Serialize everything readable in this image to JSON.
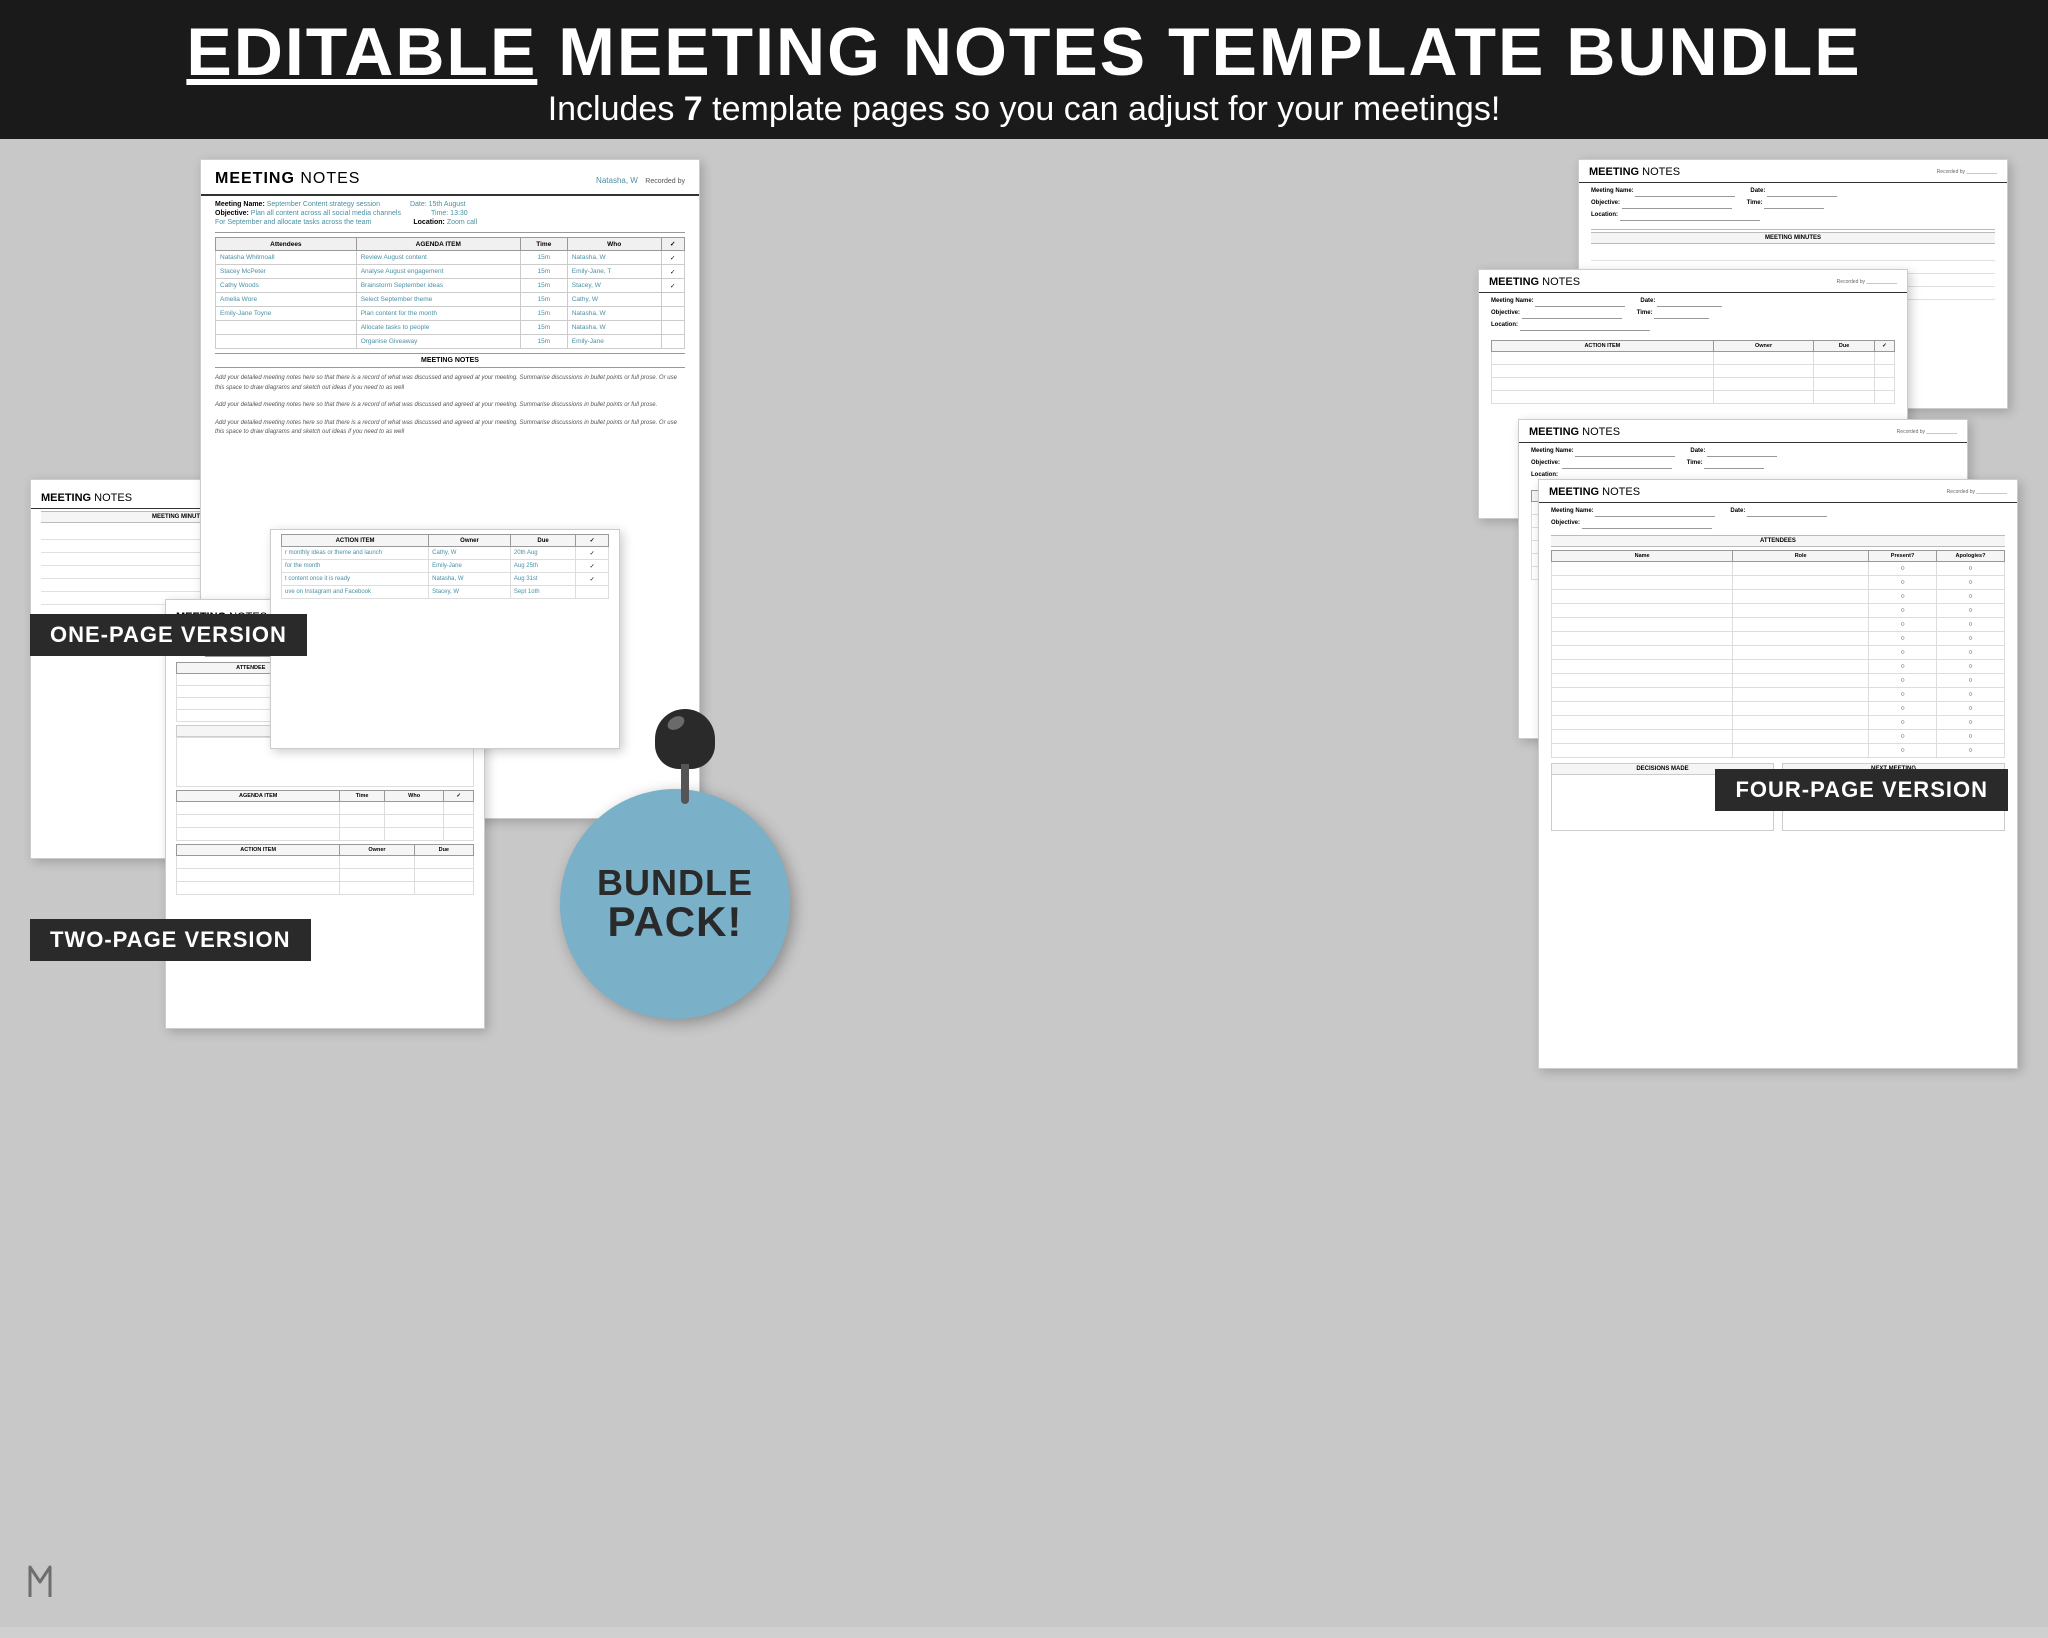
{
  "header": {
    "title_part1": "EDITABLE",
    "title_part2": " MEETING NOTES TEMPLATE BUNDLE",
    "subtitle_part1": "Includes ",
    "subtitle_bold": "7",
    "subtitle_part2": " template pages so you can adjust for your meetings!"
  },
  "versions": {
    "one_page": "ONE-PAGE VERSION",
    "two_page": "TWO-PAGE VERSION",
    "four_page": "FOUR-PAGE VERSION"
  },
  "bundle": {
    "line1": "BUNDLE",
    "line2": "PACK!"
  },
  "template_label": "MEETING",
  "notes_label": "NOTES",
  "recorded_by": "Recorded by",
  "meeting_minutes": "MEETING MINUTES",
  "agenda_item": "AGENDA ITEM",
  "action_item": "ACTION ITEM",
  "attendees": "Attendees",
  "attendees_header": "ATTENDEES",
  "time_col": "Time",
  "who_col": "Who",
  "check_col": "✓",
  "owner_col": "Owner",
  "due_col": "Due",
  "name_col": "Name",
  "role_col": "Role",
  "present_col": "Present?",
  "apologies_col": "Apologies?",
  "decisions_made": "DECISIONS MADE",
  "next_meeting": "NEXT MEETING",
  "meeting_name_label": "Meeting Name:",
  "objective_label": "Objective:",
  "date_label": "Date:",
  "time_label": "Time:",
  "location_label": "Location:",
  "sample_meeting_name": "September Content strategy session",
  "sample_date": "Date: 15th August",
  "sample_time": "Time: 13:30",
  "sample_location": "Location: Zoom call",
  "sample_objective": "Plan all content across all social media channels",
  "sample_objective2": "For September and allocate tasks across the team",
  "recorded_name": "Natasha, W",
  "attendee_rows": [
    "Natasha Whitmoall",
    "Stacey McPeter",
    "Cathy Woods",
    "Amelia Wore",
    "Emily-Jane Toyne"
  ],
  "agenda_rows": [
    {
      "item": "Review August content",
      "time": "15m",
      "who": "Natasha, W",
      "check": "✓"
    },
    {
      "item": "Analyse August engagement",
      "time": "15m",
      "who": "Emily-Jane, T",
      "check": "✓"
    },
    {
      "item": "Brainstorm September ideas",
      "time": "15m",
      "who": "Stacey, W",
      "check": "✓"
    },
    {
      "item": "Select September theme",
      "time": "15m",
      "who": "Cathy, W",
      "check": ""
    },
    {
      "item": "Plan content for the month",
      "time": "15m",
      "who": "Natasha, W",
      "check": ""
    },
    {
      "item": "Allocate tasks to people",
      "time": "15m",
      "who": "Natasha, W",
      "check": ""
    },
    {
      "item": "Organise Giveaway",
      "time": "15m",
      "who": "Emily-Jane",
      "check": ""
    }
  ],
  "action_rows": [
    {
      "item": "r monthly ideas or theme and launch",
      "owner": "Cathy, W",
      "due": "20th Aug",
      "check": "✓"
    },
    {
      "item": "for the month",
      "owner": "Emily-Jane",
      "due": "Aug 25th",
      "check": "✓"
    },
    {
      "item": "t content once it is ready",
      "owner": "Natasha, W",
      "due": "Aug 31st",
      "check": "✓"
    },
    {
      "item": "uve on Instagram and Facebook",
      "owner": "Stacey, W",
      "due": "Sept 1oth",
      "check": ""
    }
  ],
  "notes_text": [
    "Add your detailed meeting notes here so that there is a record of what was discussed and agreed at your meeting. Summarise discussions in bullet points or full prose. Or use this space to draw diagrams and sketch out ideas if you need to as well",
    "Add your detailed meeting notes here so that there is a record of what was discussed and agreed at your meeting. Summarise discussions in bullet points or full prose.",
    "Add your detailed meeting notes here so that there is a record of what was discussed and agreed at your meeting. Summarise discussions in bullet points or full prose. Or use this space to draw diagrams and sketch out ideas if you need to as well"
  ]
}
